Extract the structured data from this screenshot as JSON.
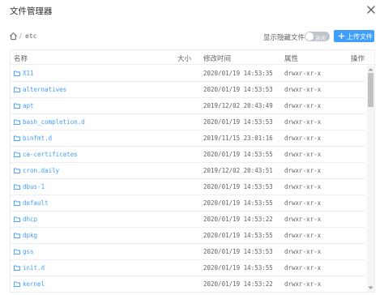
{
  "dialog": {
    "title": "文件管理器",
    "close_icon": "close-icon"
  },
  "path": {
    "home_icon": "home-icon",
    "separator": "/",
    "current": "etc"
  },
  "toolbar": {
    "show_hidden_label": "显示隐藏文件:",
    "toggle_text": "关闭",
    "upload_label": "上传文件",
    "upload_icon": "plus-icon"
  },
  "table": {
    "columns": {
      "name": "名称",
      "size": "大小",
      "modified": "修改时间",
      "attributes": "属性",
      "actions": "操作"
    },
    "rows": [
      {
        "name": "X11",
        "modified": "2020/01/19 14:53:35",
        "attr": "drwxr-xr-x"
      },
      {
        "name": "alternatives",
        "modified": "2020/01/19 14:53:53",
        "attr": "drwxr-xr-x"
      },
      {
        "name": "apt",
        "modified": "2019/12/02 20:43:49",
        "attr": "drwxr-xr-x"
      },
      {
        "name": "bash_completion.d",
        "modified": "2020/01/19 14:53:53",
        "attr": "drwxr-xr-x"
      },
      {
        "name": "binfmt.d",
        "modified": "2019/11/15 23:01:16",
        "attr": "drwxr-xr-x"
      },
      {
        "name": "ca-certificates",
        "modified": "2020/01/19 14:53:55",
        "attr": "drwxr-xr-x"
      },
      {
        "name": "cron.daily",
        "modified": "2019/12/02 20:43:51",
        "attr": "drwxr-xr-x"
      },
      {
        "name": "dbus-1",
        "modified": "2020/01/19 14:53:53",
        "attr": "drwxr-xr-x"
      },
      {
        "name": "default",
        "modified": "2020/01/19 14:53:55",
        "attr": "drwxr-xr-x"
      },
      {
        "name": "dhcp",
        "modified": "2020/01/19 14:53:22",
        "attr": "drwxr-xr-x"
      },
      {
        "name": "dpkg",
        "modified": "2020/01/19 14:53:55",
        "attr": "drwxr-xr-x"
      },
      {
        "name": "gss",
        "modified": "2020/01/19 14:53:53",
        "attr": "drwxr-xr-x"
      },
      {
        "name": "init.d",
        "modified": "2020/01/19 14:53:55",
        "attr": "drwxr-xr-x"
      },
      {
        "name": "kernel",
        "modified": "2020/01/19 14:53:22",
        "attr": "drwxr-xr-x"
      }
    ]
  },
  "colors": {
    "accent": "#409eff",
    "toggle_off": "#c0c4cc",
    "text_primary": "#303133",
    "text_secondary": "#606266",
    "border": "#ebeef5"
  }
}
